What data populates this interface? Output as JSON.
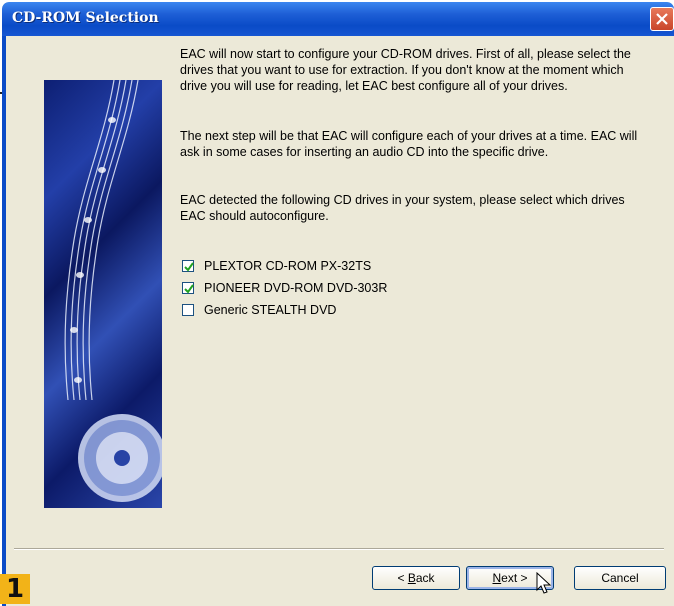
{
  "window": {
    "title": "CD-ROM Selection"
  },
  "intro": {
    "paragraph1": "EAC will now start to configure your CD-ROM drives. First of all, please select the drives that you want to use for extraction. If you don't know at the moment which drive you will use for reading, let EAC best configure all of your drives.",
    "paragraph2": "The next step will be that EAC will configure each of your drives at a time. EAC will ask in some cases for inserting an audio CD into the specific drive.",
    "paragraph3": "EAC detected the following CD drives in your system, please select which drives EAC should autoconfigure."
  },
  "drives": [
    {
      "label": "PLEXTOR CD-ROM PX-32TS",
      "checked": true
    },
    {
      "label": "PIONEER DVD-ROM DVD-303R",
      "checked": true
    },
    {
      "label": "Generic STEALTH DVD",
      "checked": false
    }
  ],
  "buttons": {
    "back_mnemonic": "B",
    "back_rest": "ack",
    "back_prefix": "< ",
    "next_mnemonic": "N",
    "next_rest": "ext >",
    "cancel": "Cancel"
  },
  "badge": "1",
  "colors": {
    "titlebar": "#0a4bc7",
    "dialog": "#ece9d8",
    "checkmark": "#21a121",
    "badge": "#f2b318"
  }
}
